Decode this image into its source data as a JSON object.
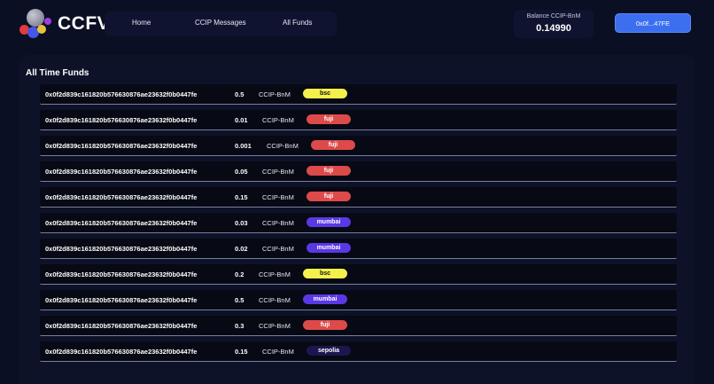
{
  "header": {
    "brand": "CCFV",
    "nav": [
      {
        "label": "Home"
      },
      {
        "label": "CCIP Messages"
      },
      {
        "label": "All Funds"
      }
    ],
    "balance_label": "Balance CCIP-BnM",
    "balance_value": "0.14990",
    "wallet_label": "0x0f...47FE"
  },
  "colors": {
    "bsc": "#f4f04c",
    "fuji": "#dc4a4a",
    "mumbai": "#5a38e6",
    "sepolia": "#1c1650",
    "wallet_button": "#3b6ff0"
  },
  "funds": {
    "title": "All Time Funds",
    "rows": [
      {
        "address": "0x0f2d839c161820b576630876ae23632f0b0447fe",
        "amount": "0.5",
        "token": "CCIP-BnM",
        "chain": "bsc"
      },
      {
        "address": "0x0f2d839c161820b576630876ae23632f0b0447fe",
        "amount": "0.01",
        "token": "CCIP-BnM",
        "chain": "fuji"
      },
      {
        "address": "0x0f2d839c161820b576630876ae23632f0b0447fe",
        "amount": "0.001",
        "token": "CCIP-BnM",
        "chain": "fuji"
      },
      {
        "address": "0x0f2d839c161820b576630876ae23632f0b0447fe",
        "amount": "0.05",
        "token": "CCIP-BnM",
        "chain": "fuji"
      },
      {
        "address": "0x0f2d839c161820b576630876ae23632f0b0447fe",
        "amount": "0.15",
        "token": "CCIP-BnM",
        "chain": "fuji"
      },
      {
        "address": "0x0f2d839c161820b576630876ae23632f0b0447fe",
        "amount": "0.03",
        "token": "CCIP-BnM",
        "chain": "mumbai"
      },
      {
        "address": "0x0f2d839c161820b576630876ae23632f0b0447fe",
        "amount": "0.02",
        "token": "CCIP-BnM",
        "chain": "mumbai"
      },
      {
        "address": "0x0f2d839c161820b576630876ae23632f0b0447fe",
        "amount": "0.2",
        "token": "CCIP-BnM",
        "chain": "bsc"
      },
      {
        "address": "0x0f2d839c161820b576630876ae23632f0b0447fe",
        "amount": "0.5",
        "token": "CCIP-BnM",
        "chain": "mumbai"
      },
      {
        "address": "0x0f2d839c161820b576630876ae23632f0b0447fe",
        "amount": "0.3",
        "token": "CCIP-BnM",
        "chain": "fuji"
      },
      {
        "address": "0x0f2d839c161820b576630876ae23632f0b0447fe",
        "amount": "0.15",
        "token": "CCIP-BnM",
        "chain": "sepolia"
      }
    ]
  }
}
